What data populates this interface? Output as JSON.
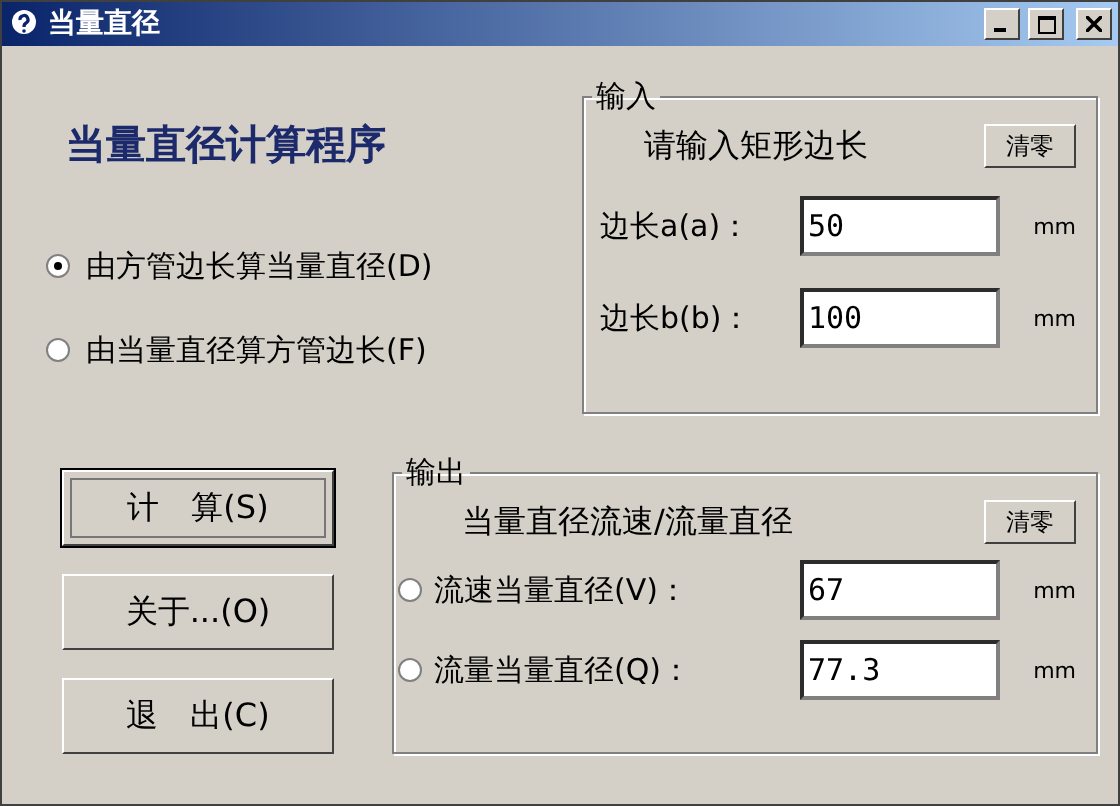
{
  "window": {
    "title": "当量直径"
  },
  "heading": "当量直径计算程序",
  "modes": [
    {
      "label": "由方管边长算当量直径(D)",
      "selected": true
    },
    {
      "label": "由当量直径算方管边长(F)",
      "selected": false
    }
  ],
  "input_group": {
    "title": "输入",
    "prompt": "请输入矩形边长",
    "clear_button": "清零",
    "fields": [
      {
        "label": "边长a(a)：",
        "value": "50",
        "unit": "mm"
      },
      {
        "label": "边长b(b)：",
        "value": "100",
        "unit": "mm"
      }
    ]
  },
  "buttons": [
    {
      "label": "计　算(S)",
      "focused": true
    },
    {
      "label": "关于...(O)",
      "focused": false
    },
    {
      "label": "退　出(C)",
      "focused": false
    }
  ],
  "output_group": {
    "title": "输出",
    "prompt": "当量直径流速/流量直径",
    "clear_button": "清零",
    "fields": [
      {
        "label": "流速当量直径(V)：",
        "value": "67",
        "unit": "mm",
        "selected": false
      },
      {
        "label": "流量当量直径(Q)：",
        "value": "77.3",
        "unit": "mm",
        "selected": false
      }
    ]
  }
}
